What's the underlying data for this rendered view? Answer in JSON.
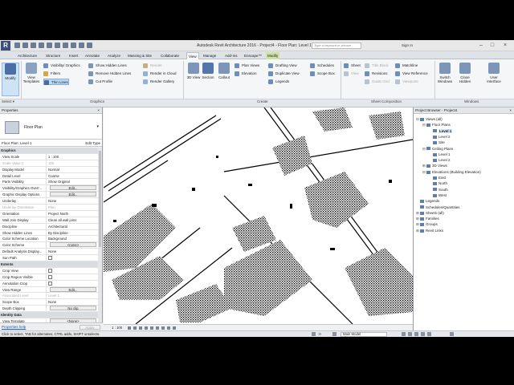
{
  "titlebar": {
    "title": "Autodesk Revit Architecture 2016 -    Project4 - Floor Plan: Level 1",
    "search_placeholder": "Type a keyword or phrase",
    "sign_in": "Sign In",
    "minimize": "–",
    "maximize": "□",
    "close": "×"
  },
  "tabs": [
    "Architecture",
    "Structure",
    "Insert",
    "Annotate",
    "Analyze",
    "Massing & Site",
    "Collaborate",
    "View",
    "Manage",
    "Add-Ins",
    "Enscape™",
    "Modify"
  ],
  "ribbon": {
    "modify": "Modify",
    "view_templates": "View Templates",
    "visibility": "Visibility/ Graphics",
    "filters": "Filters",
    "thin_lines": "Thin Lines",
    "show_hidden": "Show Hidden Lines",
    "remove_hidden": "Remove Hidden Lines",
    "cut_profile": "Cut Profile",
    "render": "Render",
    "render_cloud": "Render in Cloud",
    "render_gallery": "Render Gallery",
    "view_3d": "3D View",
    "section": "Section",
    "callout": "Callout",
    "plan_views": "Plan Views",
    "elevation": "Elevation",
    "drafting_view": "Drafting View",
    "duplicate_view": "Duplicate View",
    "legends": "Legends",
    "schedules": "Schedules",
    "scope_box": "Scope Box",
    "sheet": "Sheet",
    "view": "View",
    "title_block": "Title Block",
    "revisions": "Revisions",
    "guide_grid": "Guide Grid",
    "matchline": "Matchline",
    "view_reference": "View Reference",
    "viewports": "Viewports",
    "switch_windows": "Switch Windows",
    "close_hidden": "Close Hidden",
    "user_interface": "User Interface",
    "panels": {
      "select": "Select ▾",
      "graphics": "Graphics",
      "create": "Create",
      "sheet_composition": "Sheet Composition",
      "windows": "Windows"
    }
  },
  "properties": {
    "header": "Properties",
    "type_name": "Floor Plan",
    "instance": "Floor Plan: Level 1",
    "edit_type": "Edit Type",
    "help": "Properties help",
    "apply": "Apply",
    "rows": [
      {
        "cat": "Graphics"
      },
      {
        "k": "View Scale",
        "v": "1 : 100"
      },
      {
        "k": "Scale Value    1:",
        "v": "100",
        "dim": true
      },
      {
        "k": "Display Model",
        "v": "Normal"
      },
      {
        "k": "Detail Level",
        "v": "Coarse"
      },
      {
        "k": "Parts Visibility",
        "v": "Show Original"
      },
      {
        "k": "Visibility/Graphics Overr...",
        "btn": "Edit..."
      },
      {
        "k": "Graphic Display Options",
        "btn": "Edit..."
      },
      {
        "k": "Underlay",
        "v": "None"
      },
      {
        "k": "Underlay Orientation",
        "v": "Plan",
        "dim": true
      },
      {
        "k": "Orientation",
        "v": "Project North"
      },
      {
        "k": "Wall Join Display",
        "v": "Clean all wall joins"
      },
      {
        "k": "Discipline",
        "v": "Architectural"
      },
      {
        "k": "Show Hidden Lines",
        "v": "By Discipline"
      },
      {
        "k": "Color Scheme Location",
        "v": "Background"
      },
      {
        "k": "Color Scheme",
        "btn": "<none>"
      },
      {
        "k": "Default Analysis Display...",
        "v": "None"
      },
      {
        "k": "Sun Path",
        "cb": true
      },
      {
        "cat": "Extents"
      },
      {
        "k": "Crop View",
        "cb": true
      },
      {
        "k": "Crop Region Visible",
        "cb": true
      },
      {
        "k": "Annotation Crop",
        "cb": true
      },
      {
        "k": "View Range",
        "btn": "Edit..."
      },
      {
        "k": "Associated Level",
        "v": "Level 1",
        "dim": true
      },
      {
        "k": "Scope Box",
        "v": "None"
      },
      {
        "k": "Depth Clipping",
        "btn": "No clip"
      },
      {
        "cat": "Identity Data"
      },
      {
        "k": "View Template",
        "btn": "<None>"
      }
    ]
  },
  "browser": {
    "header": "Project Browser - Project4",
    "items": [
      {
        "label": "Views (all)",
        "lvl": 0,
        "tg": "⊟"
      },
      {
        "label": "Floor Plans",
        "lvl": 1,
        "tg": "⊟"
      },
      {
        "label": "Level 1",
        "lvl": 2,
        "tg": "",
        "sel": true
      },
      {
        "label": "Level 2",
        "lvl": 2,
        "tg": ""
      },
      {
        "label": "Site",
        "lvl": 2,
        "tg": ""
      },
      {
        "label": "Ceiling Plans",
        "lvl": 1,
        "tg": "⊟"
      },
      {
        "label": "Level 1",
        "lvl": 2,
        "tg": ""
      },
      {
        "label": "Level 2",
        "lvl": 2,
        "tg": ""
      },
      {
        "label": "3D Views",
        "lvl": 1,
        "tg": "⊞"
      },
      {
        "label": "Elevations (Building Elevation)",
        "lvl": 1,
        "tg": "⊟"
      },
      {
        "label": "East",
        "lvl": 2,
        "tg": ""
      },
      {
        "label": "North",
        "lvl": 2,
        "tg": ""
      },
      {
        "label": "South",
        "lvl": 2,
        "tg": ""
      },
      {
        "label": "West",
        "lvl": 2,
        "tg": ""
      },
      {
        "label": "Legends",
        "lvl": 0,
        "tg": ""
      },
      {
        "label": "Schedules/Quantities",
        "lvl": 0,
        "tg": ""
      },
      {
        "label": "Sheets (all)",
        "lvl": 0,
        "tg": "⊞"
      },
      {
        "label": "Families",
        "lvl": 0,
        "tg": "⊞"
      },
      {
        "label": "Groups",
        "lvl": 0,
        "tg": "⊞"
      },
      {
        "label": "Revit Links",
        "lvl": 0,
        "tg": "⊞"
      }
    ]
  },
  "viewbar": {
    "scale": "1 : 100"
  },
  "status": {
    "message": "Click to select, TAB for alternates, CTRL adds, SHIFT unselects.",
    "model": "Main Model",
    "zero": ":0"
  },
  "colors": {
    "accent": "#3b4f7a",
    "selection": "#cfe3f7",
    "modify_tab": "#cfe0a7"
  }
}
